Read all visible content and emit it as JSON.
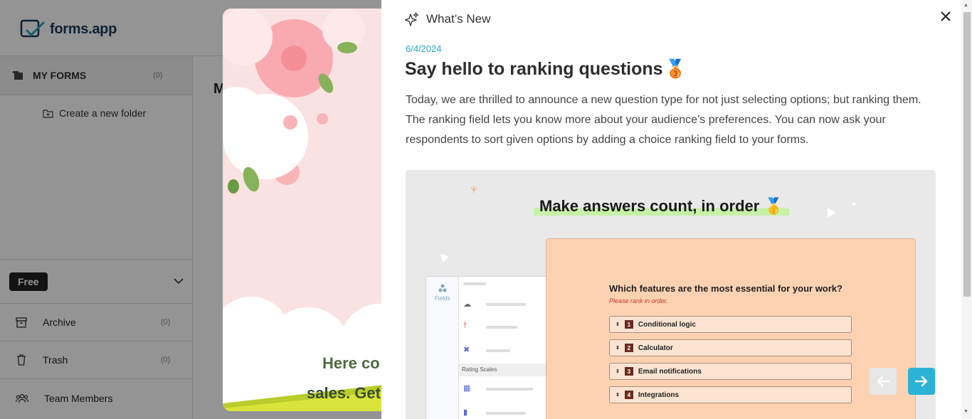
{
  "app": {
    "logo_text": "forms.app",
    "sidebar": {
      "my_forms_label": "MY FORMS",
      "my_forms_count": "(0)",
      "create_folder_label": "Create a new folder",
      "plan_label": "Free",
      "items": [
        {
          "label": "Archive",
          "count": "(0)",
          "icon": "archive-icon"
        },
        {
          "label": "Trash",
          "count": "(0)",
          "icon": "trash-icon"
        },
        {
          "label": "Team Members",
          "count": "",
          "icon": "team-icon"
        }
      ]
    },
    "main_title_partial": "M"
  },
  "promo": {
    "line1": "Here co",
    "line2": "sales. Get"
  },
  "whats_new": {
    "title": "What’s New",
    "date": "6/4/2024",
    "headline": "Say hello to ranking questions",
    "headline_emoji": "🥉",
    "paragraph1": "Today, we are thrilled to announce a new question type for not just selecting options; but ranking them.",
    "paragraph2": "The ranking field lets you know more about your audience’s preferences. You can now ask your respondents to sort given options by adding a choice ranking field to your forms.",
    "hero": {
      "title": "Make answers count, in order",
      "title_emoji": "🥇",
      "builder_fields_label": "Fields",
      "builder_rating_label": "Rating Scales",
      "question": "Which features are the most essential for your work?",
      "question_hint": "Please rank in order.",
      "options": [
        {
          "rank": "1",
          "label": "Conditional logic"
        },
        {
          "rank": "2",
          "label": "Calculator"
        },
        {
          "rank": "3",
          "label": "Email notifications"
        },
        {
          "rank": "4",
          "label": "Integrations"
        }
      ]
    }
  },
  "colors": {
    "accent": "#27a7c7",
    "next_button": "#2bb3d6",
    "hero_highlight": "#c6f1a8",
    "form_card": "#fdd2b3"
  }
}
